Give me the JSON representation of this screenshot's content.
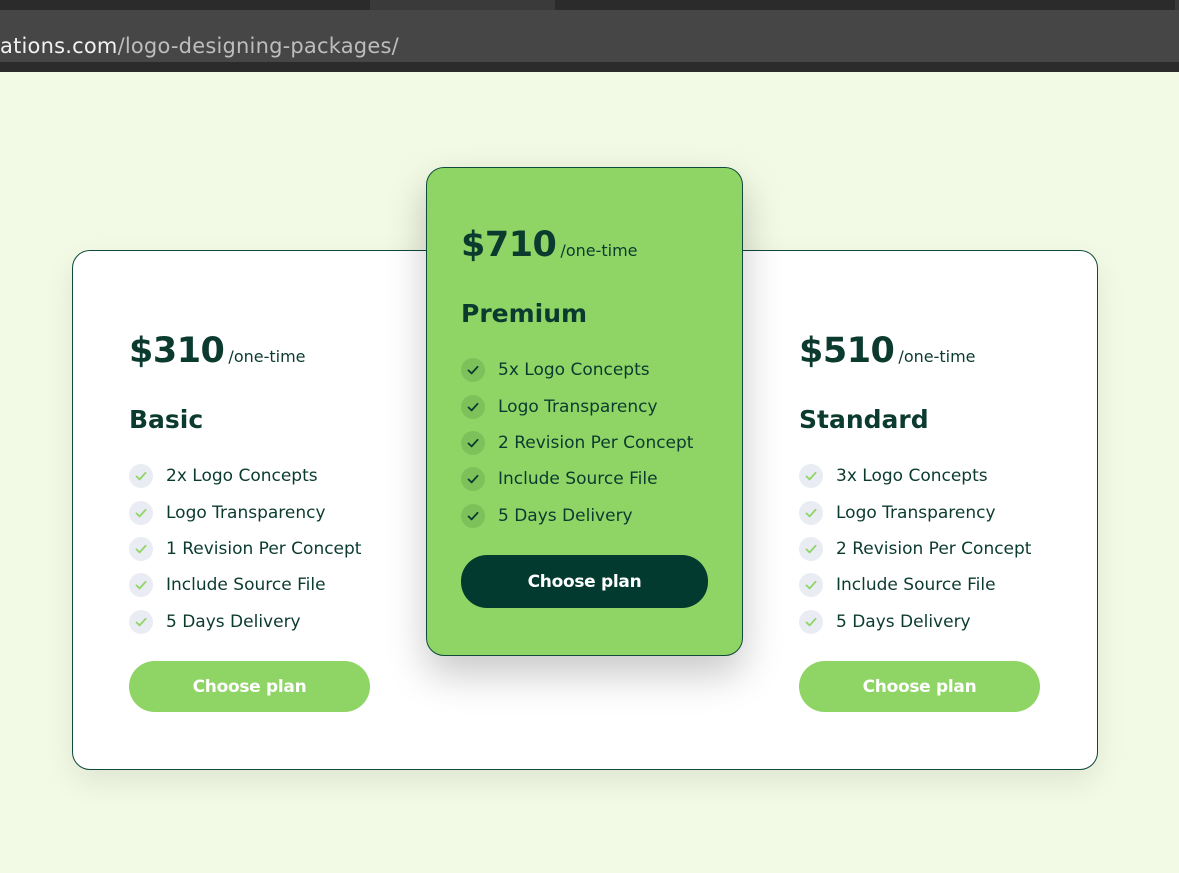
{
  "browser": {
    "url_host_partial": "ations.com",
    "url_path": "/logo-designing-packages/"
  },
  "colors": {
    "page_background": "#f2f9e4",
    "accent_green": "#8fd566",
    "dark_green": "#033a30",
    "text_dark": "#0b3a2f"
  },
  "plans": {
    "basic": {
      "price": "$310",
      "period": "/one-time",
      "name": "Basic",
      "features": [
        "2x Logo Concepts",
        "Logo Transparency",
        "1 Revision Per Concept",
        "Include Source File",
        "5 Days Delivery"
      ],
      "button_label": "Choose plan",
      "icon": "check-icon"
    },
    "premium": {
      "price": "$710",
      "period": "/one-time",
      "name": "Premium",
      "features": [
        "5x Logo Concepts",
        "Logo Transparency",
        "2 Revision Per Concept",
        "Include Source File",
        "5 Days Delivery"
      ],
      "button_label": "Choose plan",
      "icon": "check-icon"
    },
    "standard": {
      "price": "$510",
      "period": "/one-time",
      "name": "Standard",
      "features": [
        "3x Logo Concepts",
        "Logo Transparency",
        "2 Revision Per Concept",
        "Include Source File",
        "5 Days Delivery"
      ],
      "button_label": "Choose plan",
      "icon": "check-icon"
    }
  }
}
